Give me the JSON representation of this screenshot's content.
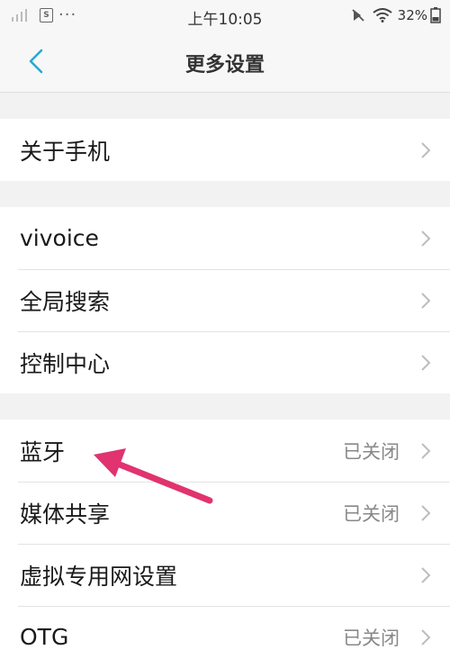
{
  "status_bar": {
    "sim_label": "S",
    "more_dots": "···",
    "time": "上午10:05",
    "battery_percent": "32%"
  },
  "nav": {
    "title": "更多设置"
  },
  "sections": [
    {
      "rows": [
        {
          "label": "关于手机",
          "value": ""
        }
      ]
    },
    {
      "rows": [
        {
          "label": "vivoice",
          "value": ""
        },
        {
          "label": "全局搜索",
          "value": ""
        },
        {
          "label": "控制中心",
          "value": ""
        }
      ]
    },
    {
      "rows": [
        {
          "label": "蓝牙",
          "value": "已关闭"
        },
        {
          "label": "媒体共享",
          "value": "已关闭"
        },
        {
          "label": "虚拟专用网设置",
          "value": ""
        },
        {
          "label": "OTG",
          "value": "已关闭"
        }
      ]
    }
  ],
  "annotation": {
    "color": "#e0336f"
  }
}
